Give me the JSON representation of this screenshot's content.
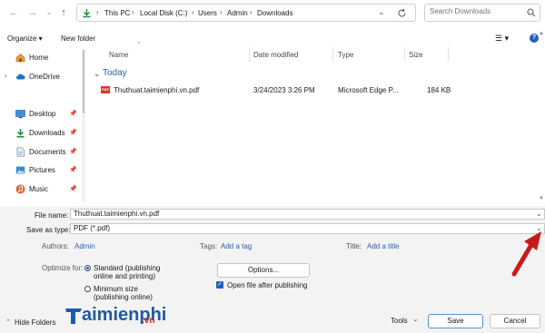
{
  "address_bar": {
    "crumbs": [
      "This PC",
      "Local Disk (C:)",
      "Users",
      "Admin",
      "Downloads"
    ],
    "search_placeholder": "Search Downloads"
  },
  "toolbar": {
    "organize_label": "Organize ▾",
    "new_folder_label": "New folder",
    "view_icon": "☰ ▾",
    "help_icon": "?"
  },
  "nav_pane": {
    "items": [
      {
        "label": "Home",
        "icon": "home-icon"
      },
      {
        "label": "OneDrive",
        "icon": "cloud-icon"
      },
      {
        "label": "Desktop",
        "icon": "desktop-icon"
      },
      {
        "label": "Downloads",
        "icon": "download-icon"
      },
      {
        "label": "Documents",
        "icon": "documents-icon"
      },
      {
        "label": "Pictures",
        "icon": "pictures-icon"
      },
      {
        "label": "Music",
        "icon": "music-icon"
      }
    ]
  },
  "file_list": {
    "columns": {
      "name": "Name",
      "date_modified": "Date modified",
      "type": "Type",
      "size": "Size"
    },
    "group_label": "Today",
    "files": [
      {
        "name": "Thuthuat.taimienphi.vn.pdf",
        "date": "3/24/2023 3:26 PM",
        "type": "Microsoft Edge P...",
        "size": "184 KB",
        "icon_text": "PDF"
      }
    ]
  },
  "form": {
    "file_name_label": "File name:",
    "file_name_value": "Thuthuat.taimienphi.vn.pdf",
    "save_type_label": "Save as type:",
    "save_type_value": "PDF (*.pdf)",
    "authors_label": "Authors:",
    "authors_value": "Admin",
    "tags_label": "Tags:",
    "tags_value": "Add a tag",
    "title_label": "Title:",
    "title_value": "Add a title",
    "optimize_label": "Optimize for:",
    "optimize_standard": "Standard (publishing online and printing)",
    "optimize_minimum": "Minimum size (publishing online)",
    "options_label": "Options...",
    "open_after_label": "Open file after publishing"
  },
  "footer": {
    "hide_folders_label": "Hide Folders",
    "tools_label": "Tools",
    "save_label": "Save",
    "cancel_label": "Cancel"
  },
  "watermark": {
    "brand_main": "aimienphi",
    "brand_suffix": ".vn"
  }
}
